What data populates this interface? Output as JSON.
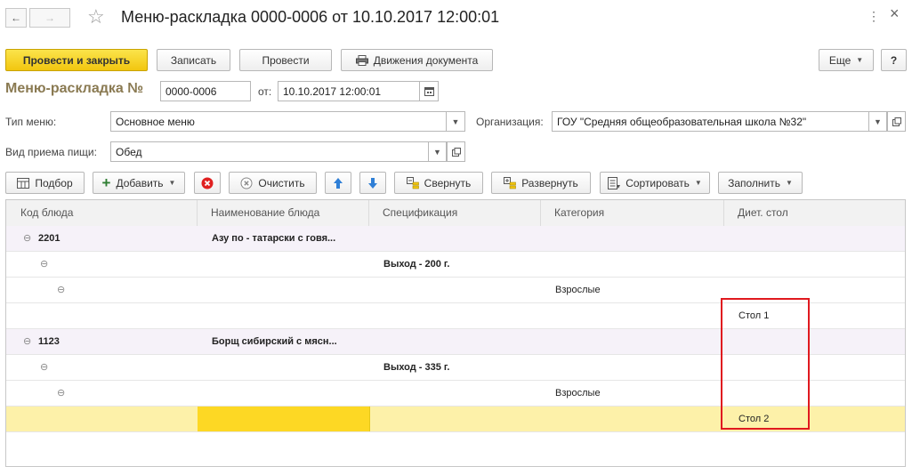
{
  "window": {
    "title": "Меню-раскладка 0000-0006 от 10.10.2017 12:00:01",
    "back_icon": "←",
    "forward_icon": "→",
    "star_icon": "☆",
    "menu_icon": "⋮",
    "close_icon": "×"
  },
  "toolbar": {
    "post_close": "Провести и закрыть",
    "save": "Записать",
    "post": "Провести",
    "movements": "Движения документа",
    "more": "Еще",
    "help": "?"
  },
  "header": {
    "doc_label": "Меню-раскладка №",
    "doc_number": "0000-0006",
    "from_label": "от:",
    "date": "10.10.2017 12:00:01"
  },
  "form": {
    "menu_type_label": "Тип меню:",
    "menu_type": "Основное меню",
    "org_label": "Организация:",
    "org": "ГОУ \"Средняя общеобразовательная школа №32\"",
    "meal_label": "Вид приема пищи:",
    "meal": "Обед"
  },
  "table_toolbar": {
    "pick": "Подбор",
    "add": "Добавить",
    "clear": "Очистить",
    "collapse": "Свернуть",
    "expand": "Развернуть",
    "sort": "Сортировать",
    "fill": "Заполнить"
  },
  "table": {
    "columns": [
      "Код блюда",
      "Наименование блюда",
      "Спецификация",
      "Категория",
      "Диет. стол"
    ],
    "rows": [
      {
        "code": "2201",
        "name": "Азу по - татарски с говя...",
        "spec": "",
        "cat": "",
        "diet": ""
      },
      {
        "code": "",
        "name": "",
        "spec": "Выход - 200 г.",
        "cat": "",
        "diet": ""
      },
      {
        "code": "",
        "name": "",
        "spec": "",
        "cat": "Взрослые",
        "diet": ""
      },
      {
        "code": "",
        "name": "",
        "spec": "",
        "cat": "",
        "diet": "Стол 1"
      },
      {
        "code": "1123",
        "name": "Борщ сибирский с мясн...",
        "spec": "",
        "cat": "",
        "diet": ""
      },
      {
        "code": "",
        "name": "",
        "spec": "Выход - 335 г.",
        "cat": "",
        "diet": ""
      },
      {
        "code": "",
        "name": "",
        "spec": "",
        "cat": "Взрослые",
        "diet": ""
      },
      {
        "code": "",
        "name": "",
        "spec": "",
        "cat": "",
        "diet": "Стол 2"
      }
    ]
  },
  "colors": {
    "primary_button": "#f2c60f",
    "selected_row": "#fdf1a9",
    "selected_cell": "#fdd824",
    "highlight_box": "#e0191f",
    "group_row": "#f6f2f9"
  }
}
